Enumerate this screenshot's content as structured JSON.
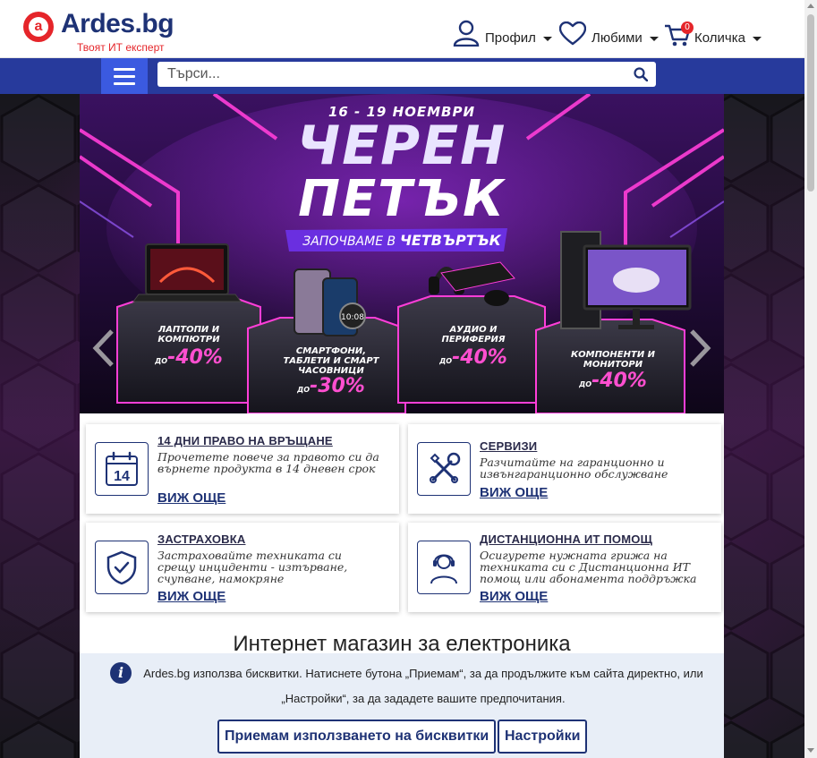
{
  "header": {
    "logo_text": "Ardes.bg",
    "logo_letter": "a",
    "tagline": "Твоят ИТ експерт",
    "profile_label": "Профил",
    "favorites_label": "Любими",
    "cart_label": "Количка",
    "cart_count": "0"
  },
  "nav": {
    "search_placeholder": "Търси..."
  },
  "banner": {
    "dates": "16 - 19 НОЕМВРИ",
    "title_line1": "ЧЕРЕН",
    "title_line2": "ПЕТЪК",
    "subtitle_prefix": "ЗАПОЧВАМЕ В",
    "subtitle_strong": "ЧЕТВЪРТЪК",
    "pedestals": [
      {
        "label": "ЛАПТОПИ И КОМПЮТРИ",
        "prefix": "ДО",
        "discount": "-40%"
      },
      {
        "label": "СМАРТФОНИ, ТАБЛЕТИ И СМАРТ ЧАСОВНИЦИ",
        "prefix": "ДО",
        "discount": "-30%"
      },
      {
        "label": "АУДИО И ПЕРИФЕРИЯ",
        "prefix": "ДО",
        "discount": "-40%"
      },
      {
        "label": "КОМПОНЕНТИ И МОНИТОРИ",
        "prefix": "ДО",
        "discount": "-40%"
      }
    ],
    "calendar_number": "14"
  },
  "services": [
    {
      "title": "14 ДНИ ПРАВО НА ВРЪЩАНЕ",
      "text": "Прочетете повече за правото си да върнете продукта в 14 дневен срок",
      "more": "ВИЖ ОЩЕ",
      "icon": "calendar-icon"
    },
    {
      "title": "СЕРВИЗИ",
      "text": "Разчитайте на гаранционно и извънгаранционно обслужване",
      "more": "ВИЖ ОЩЕ",
      "icon": "tools-icon"
    },
    {
      "title": "ЗАСТРАХОВКА",
      "text": "Застраховайте техниката си срещу инциденти - изтърване, счупване, намокряне",
      "more": "ВИЖ ОЩЕ",
      "icon": "shield-icon"
    },
    {
      "title": "ДИСТАНЦИОННА ИТ ПОМОЩ",
      "text": "Осигурете нужната грижа на техниката си с Дистанционна ИТ помощ или абонамента поддръжка",
      "more": "ВИЖ ОЩЕ",
      "icon": "support-agent-icon"
    }
  ],
  "shop_title": "Интернет магазин за електроника",
  "cookie": {
    "icon": "info-icon",
    "text": "Ardes.bg използва бисквитки. Натиснете бутона „Приемам“, за да продължите към сайта директно, или „Настройки“, за да зададете вашите предпочитания.",
    "accept_label": "Приемам използването на бисквитки",
    "settings_label": "Настройки"
  },
  "colors": {
    "brand_blue": "#1e3275",
    "nav_blue": "#273a9c",
    "brand_red": "#e5252a",
    "neon_pink": "#ff4fd0"
  }
}
